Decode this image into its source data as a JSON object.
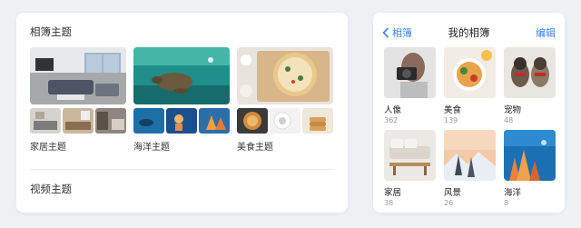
{
  "themes_card": {
    "title": "相簿主题",
    "video_title": "视频主题",
    "themes": [
      {
        "label": "家居主题"
      },
      {
        "label": "海洋主题"
      },
      {
        "label": "美食主题"
      }
    ]
  },
  "albums_card": {
    "back_label": "相簿",
    "title": "我的相簿",
    "edit_label": "编辑",
    "albums": [
      {
        "name": "人像",
        "count": "362"
      },
      {
        "name": "美食",
        "count": "139"
      },
      {
        "name": "宠物",
        "count": "48"
      },
      {
        "name": "家居",
        "count": "38"
      },
      {
        "name": "风景",
        "count": "26"
      },
      {
        "name": "海洋",
        "count": "8"
      }
    ]
  },
  "colors": {
    "accent": "#3b82f6",
    "background": "#eef0f4",
    "card": "#ffffff"
  }
}
